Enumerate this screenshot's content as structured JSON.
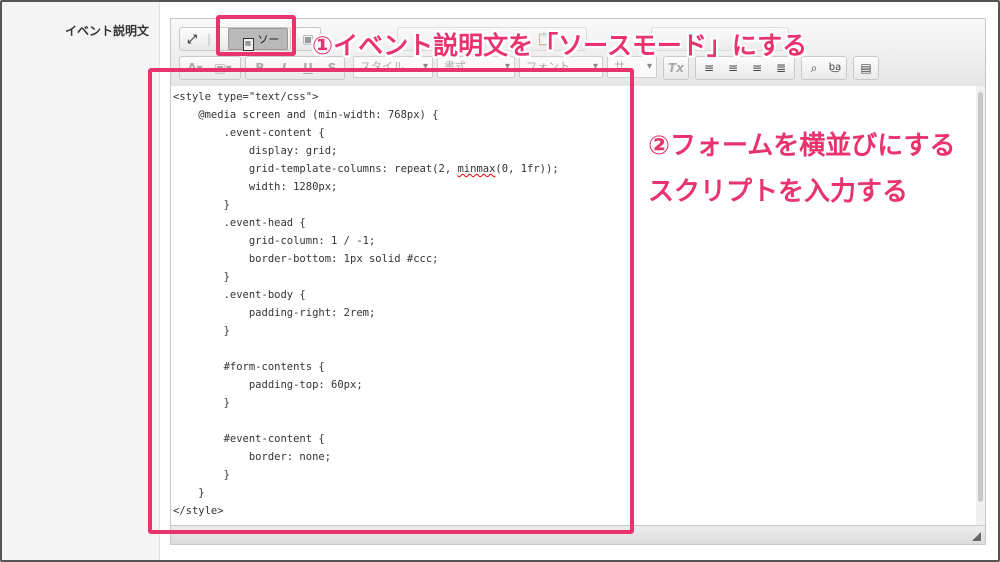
{
  "form": {
    "field_label": "イベント説明文"
  },
  "toolbar": {
    "source_label": "ソース",
    "styles_combo": "スタイル",
    "format_combo": "書式",
    "font_combo": "フォント",
    "size_combo": "サ",
    "bold": "B",
    "italic": "I",
    "underline": "U",
    "strike": "S"
  },
  "editor": {
    "code_lines": [
      "<style type=\"text/css\">",
      "    @media screen and (min-width: 768px) {",
      "        .event-content {",
      "            display: grid;",
      "            grid-template-columns: repeat(2, minmax(0, 1fr));",
      "            width: 1280px;",
      "        }",
      "        .event-head {",
      "            grid-column: 1 / -1;",
      "            border-bottom: 1px solid #ccc;",
      "        }",
      "        .event-body {",
      "            padding-right: 2rem;",
      "        }",
      "",
      "        #form-contents {",
      "            padding-top: 60px;",
      "        }",
      "",
      "        #event-content {",
      "            border: none;",
      "        }",
      "    }",
      "</style>"
    ]
  },
  "annotations": {
    "step1": "①イベント説明文を「ソースモード」にする",
    "step2_line1": "②フォームを横並びにする",
    "step2_line2": "スクリプトを入力する"
  },
  "colors": {
    "annotation": "#e8336d"
  }
}
